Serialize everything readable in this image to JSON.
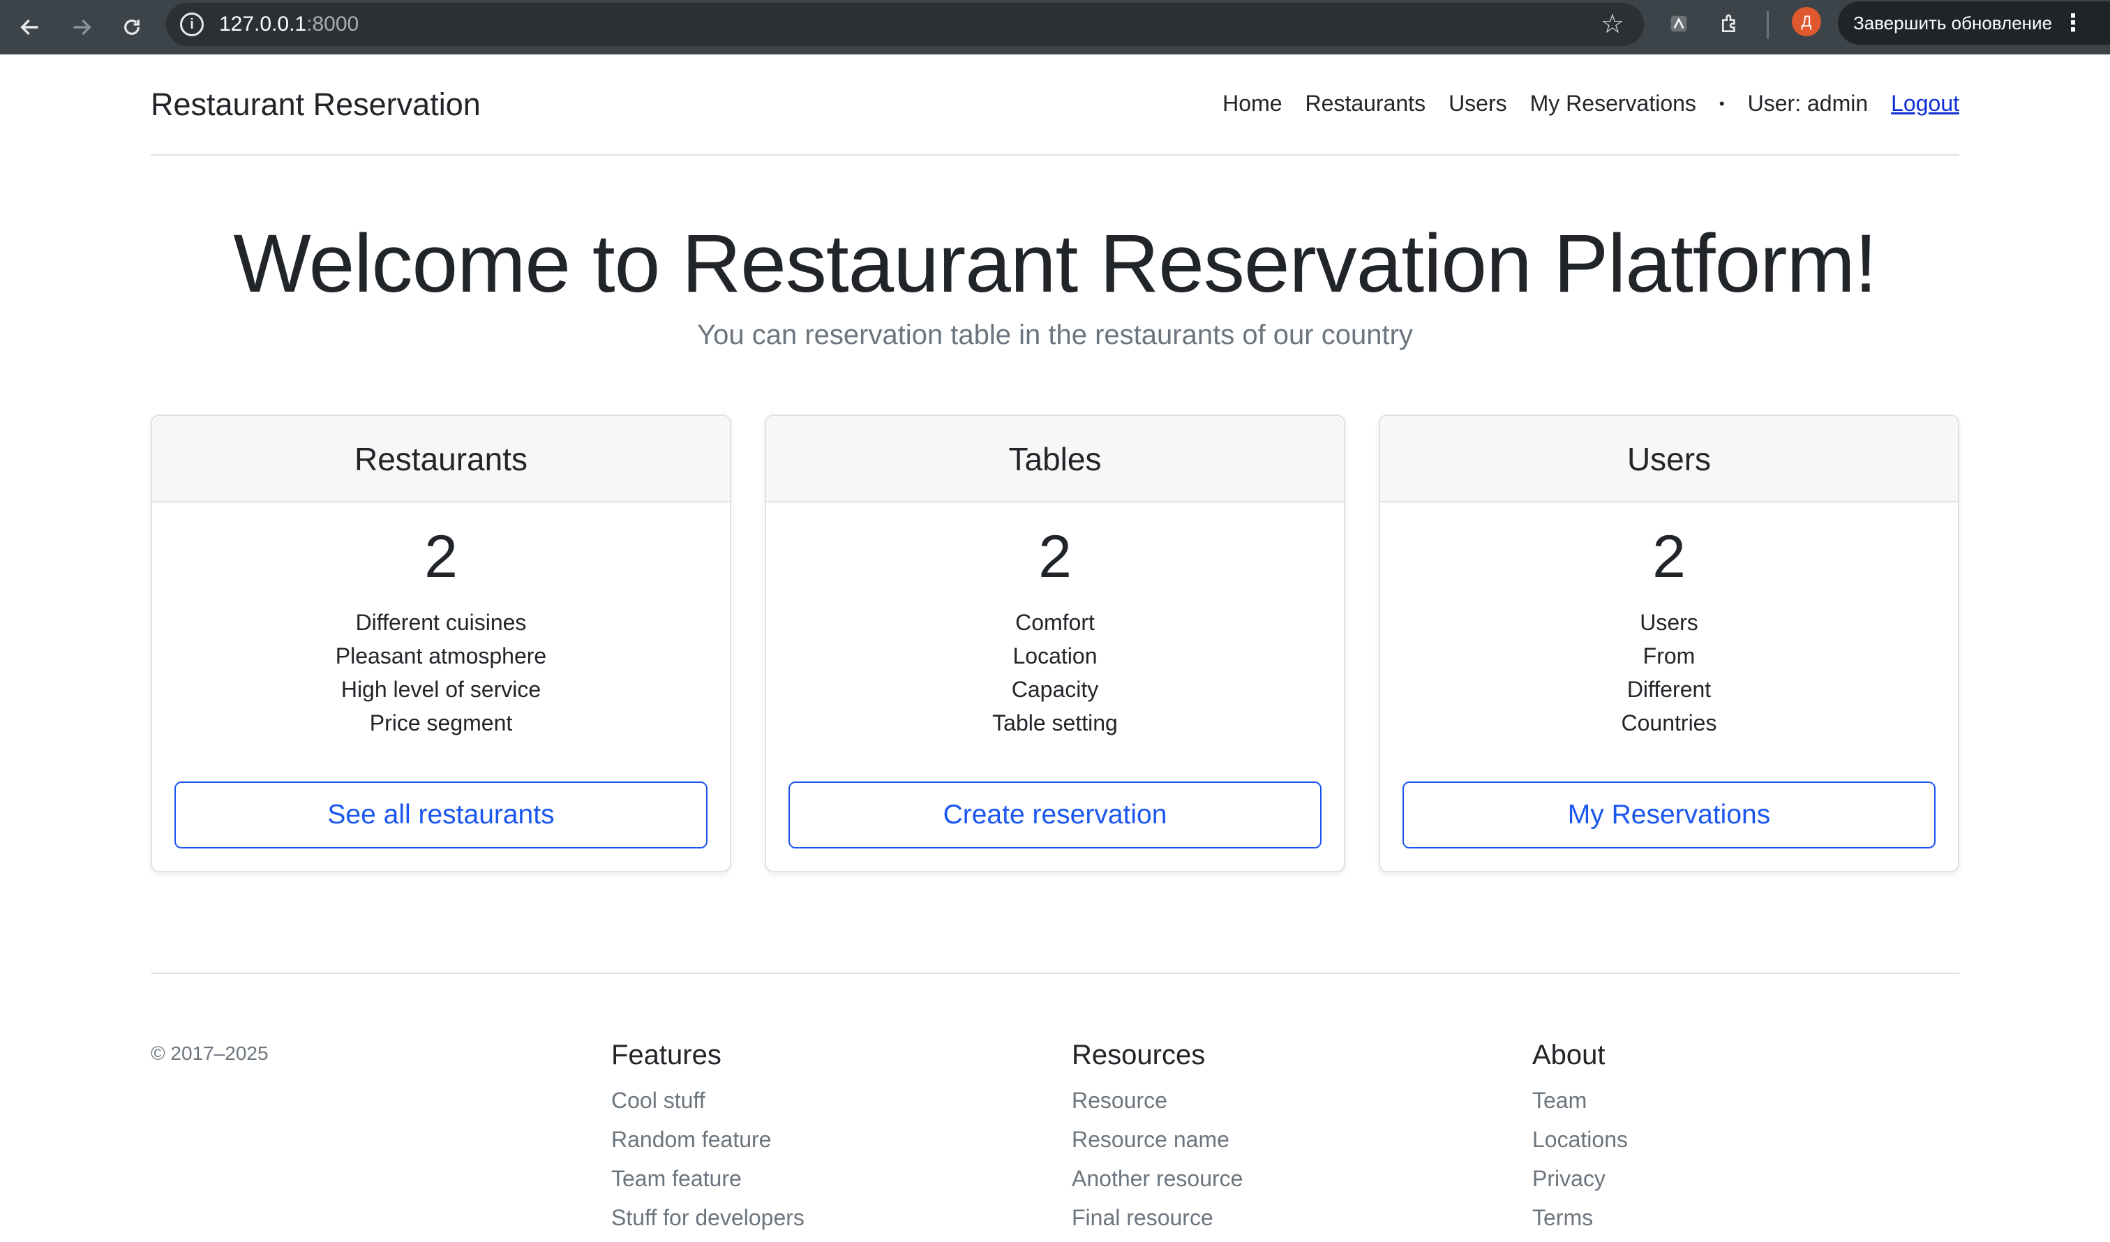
{
  "browser": {
    "url_host": "127.0.0.1",
    "url_port": ":8000",
    "profile_initial": "Д",
    "update_label": "Завершить обновление"
  },
  "header": {
    "brand": "Restaurant Reservation",
    "nav": {
      "home": "Home",
      "restaurants": "Restaurants",
      "users": "Users",
      "my_reservations": "My Reservations",
      "separator": "•",
      "user": "User: admin",
      "logout": "Logout"
    }
  },
  "hero": {
    "title": "Welcome to Restaurant Reservation Platform!",
    "subtitle": "You can reservation table in the restaurants of our country"
  },
  "cards": [
    {
      "title": "Restaurants",
      "count": "2",
      "lines": [
        "Different cuisines",
        "Pleasant atmosphere",
        "High level of service",
        "Price segment"
      ],
      "button": "See all restaurants"
    },
    {
      "title": "Tables",
      "count": "2",
      "lines": [
        "Comfort",
        "Location",
        "Capacity",
        "Table setting"
      ],
      "button": "Create reservation"
    },
    {
      "title": "Users",
      "count": "2",
      "lines": [
        "Users",
        "From",
        "Different",
        "Countries"
      ],
      "button": "My Reservations"
    }
  ],
  "footer": {
    "copyright": "© 2017–2025",
    "columns": [
      {
        "title": "Features",
        "links": [
          "Cool stuff",
          "Random feature",
          "Team feature",
          "Stuff for developers"
        ]
      },
      {
        "title": "Resources",
        "links": [
          "Resource",
          "Resource name",
          "Another resource",
          "Final resource"
        ]
      },
      {
        "title": "About",
        "links": [
          "Team",
          "Locations",
          "Privacy",
          "Terms"
        ]
      }
    ]
  },
  "colors": {
    "accent": "#1a56f0",
    "link": "#0d2fd6",
    "chrome_bg": "#3c4449",
    "profile": "#e0582d"
  }
}
